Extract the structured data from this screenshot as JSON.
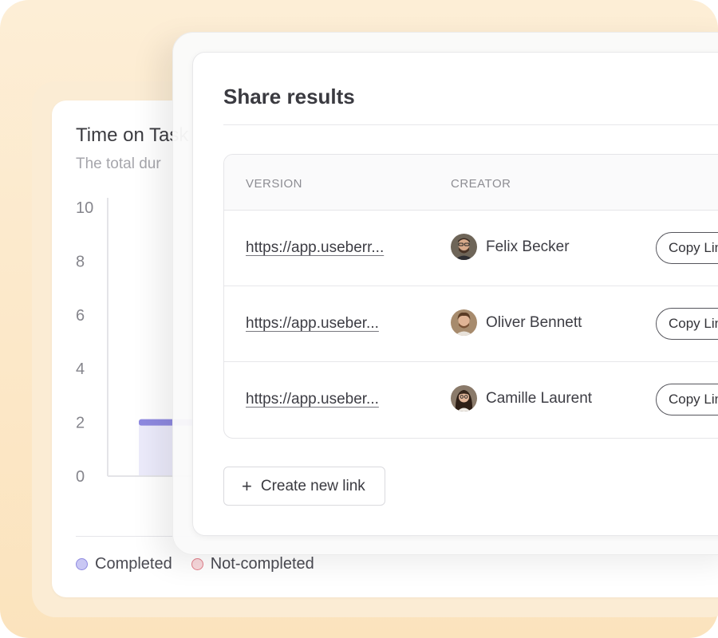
{
  "chart": {
    "title": "Time on Task",
    "subtitle": "The total dur",
    "legend": [
      {
        "label": "Completed",
        "color": "#8e89e0"
      },
      {
        "label": "Not-completed",
        "color": "#e27f8a"
      }
    ]
  },
  "chart_data": {
    "type": "bar",
    "title": "Time on Task",
    "ylim": [
      0,
      10
    ],
    "yticks": [
      "0",
      "2",
      "4",
      "6",
      "8",
      "10"
    ],
    "series": [
      {
        "name": "Completed",
        "values": [
          2
        ],
        "color": "#8e89e0"
      }
    ],
    "legend": [
      "Completed",
      "Not-completed"
    ]
  },
  "share": {
    "title": "Share results",
    "columns": {
      "version": "VERSION",
      "creator": "CREATOR"
    },
    "rows": [
      {
        "link": "https://app.useberr...",
        "creator": "Felix Becker",
        "avatar": "felix-avatar",
        "action": "Copy Link"
      },
      {
        "link": "https://app.useber...",
        "creator": "Oliver Bennett",
        "avatar": "oliver-avatar",
        "action": "Copy Link"
      },
      {
        "link": "https://app.useber...",
        "creator": "Camille Laurent",
        "avatar": "camille-avatar",
        "action": "Copy Link"
      }
    ],
    "create_button": {
      "icon": "+",
      "label": "Create new link"
    }
  },
  "colors": {
    "accent": "#8e89e0",
    "warm_background": "#fbe3bd"
  }
}
